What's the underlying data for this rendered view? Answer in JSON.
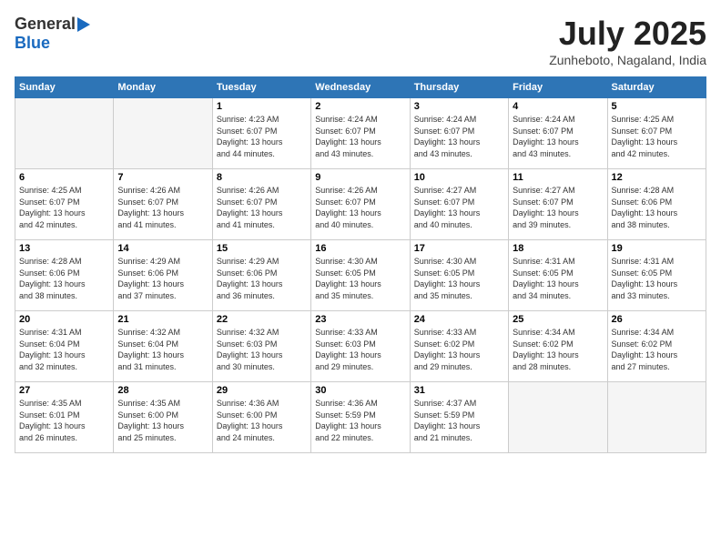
{
  "header": {
    "logo_general": "General",
    "logo_blue": "Blue",
    "month_title": "July 2025",
    "location": "Zunheboto, Nagaland, India"
  },
  "weekdays": [
    "Sunday",
    "Monday",
    "Tuesday",
    "Wednesday",
    "Thursday",
    "Friday",
    "Saturday"
  ],
  "weeks": [
    [
      {
        "day": "",
        "info": ""
      },
      {
        "day": "",
        "info": ""
      },
      {
        "day": "1",
        "info": "Sunrise: 4:23 AM\nSunset: 6:07 PM\nDaylight: 13 hours\nand 44 minutes."
      },
      {
        "day": "2",
        "info": "Sunrise: 4:24 AM\nSunset: 6:07 PM\nDaylight: 13 hours\nand 43 minutes."
      },
      {
        "day": "3",
        "info": "Sunrise: 4:24 AM\nSunset: 6:07 PM\nDaylight: 13 hours\nand 43 minutes."
      },
      {
        "day": "4",
        "info": "Sunrise: 4:24 AM\nSunset: 6:07 PM\nDaylight: 13 hours\nand 43 minutes."
      },
      {
        "day": "5",
        "info": "Sunrise: 4:25 AM\nSunset: 6:07 PM\nDaylight: 13 hours\nand 42 minutes."
      }
    ],
    [
      {
        "day": "6",
        "info": "Sunrise: 4:25 AM\nSunset: 6:07 PM\nDaylight: 13 hours\nand 42 minutes."
      },
      {
        "day": "7",
        "info": "Sunrise: 4:26 AM\nSunset: 6:07 PM\nDaylight: 13 hours\nand 41 minutes."
      },
      {
        "day": "8",
        "info": "Sunrise: 4:26 AM\nSunset: 6:07 PM\nDaylight: 13 hours\nand 41 minutes."
      },
      {
        "day": "9",
        "info": "Sunrise: 4:26 AM\nSunset: 6:07 PM\nDaylight: 13 hours\nand 40 minutes."
      },
      {
        "day": "10",
        "info": "Sunrise: 4:27 AM\nSunset: 6:07 PM\nDaylight: 13 hours\nand 40 minutes."
      },
      {
        "day": "11",
        "info": "Sunrise: 4:27 AM\nSunset: 6:07 PM\nDaylight: 13 hours\nand 39 minutes."
      },
      {
        "day": "12",
        "info": "Sunrise: 4:28 AM\nSunset: 6:06 PM\nDaylight: 13 hours\nand 38 minutes."
      }
    ],
    [
      {
        "day": "13",
        "info": "Sunrise: 4:28 AM\nSunset: 6:06 PM\nDaylight: 13 hours\nand 38 minutes."
      },
      {
        "day": "14",
        "info": "Sunrise: 4:29 AM\nSunset: 6:06 PM\nDaylight: 13 hours\nand 37 minutes."
      },
      {
        "day": "15",
        "info": "Sunrise: 4:29 AM\nSunset: 6:06 PM\nDaylight: 13 hours\nand 36 minutes."
      },
      {
        "day": "16",
        "info": "Sunrise: 4:30 AM\nSunset: 6:05 PM\nDaylight: 13 hours\nand 35 minutes."
      },
      {
        "day": "17",
        "info": "Sunrise: 4:30 AM\nSunset: 6:05 PM\nDaylight: 13 hours\nand 35 minutes."
      },
      {
        "day": "18",
        "info": "Sunrise: 4:31 AM\nSunset: 6:05 PM\nDaylight: 13 hours\nand 34 minutes."
      },
      {
        "day": "19",
        "info": "Sunrise: 4:31 AM\nSunset: 6:05 PM\nDaylight: 13 hours\nand 33 minutes."
      }
    ],
    [
      {
        "day": "20",
        "info": "Sunrise: 4:31 AM\nSunset: 6:04 PM\nDaylight: 13 hours\nand 32 minutes."
      },
      {
        "day": "21",
        "info": "Sunrise: 4:32 AM\nSunset: 6:04 PM\nDaylight: 13 hours\nand 31 minutes."
      },
      {
        "day": "22",
        "info": "Sunrise: 4:32 AM\nSunset: 6:03 PM\nDaylight: 13 hours\nand 30 minutes."
      },
      {
        "day": "23",
        "info": "Sunrise: 4:33 AM\nSunset: 6:03 PM\nDaylight: 13 hours\nand 29 minutes."
      },
      {
        "day": "24",
        "info": "Sunrise: 4:33 AM\nSunset: 6:02 PM\nDaylight: 13 hours\nand 29 minutes."
      },
      {
        "day": "25",
        "info": "Sunrise: 4:34 AM\nSunset: 6:02 PM\nDaylight: 13 hours\nand 28 minutes."
      },
      {
        "day": "26",
        "info": "Sunrise: 4:34 AM\nSunset: 6:02 PM\nDaylight: 13 hours\nand 27 minutes."
      }
    ],
    [
      {
        "day": "27",
        "info": "Sunrise: 4:35 AM\nSunset: 6:01 PM\nDaylight: 13 hours\nand 26 minutes."
      },
      {
        "day": "28",
        "info": "Sunrise: 4:35 AM\nSunset: 6:00 PM\nDaylight: 13 hours\nand 25 minutes."
      },
      {
        "day": "29",
        "info": "Sunrise: 4:36 AM\nSunset: 6:00 PM\nDaylight: 13 hours\nand 24 minutes."
      },
      {
        "day": "30",
        "info": "Sunrise: 4:36 AM\nSunset: 5:59 PM\nDaylight: 13 hours\nand 22 minutes."
      },
      {
        "day": "31",
        "info": "Sunrise: 4:37 AM\nSunset: 5:59 PM\nDaylight: 13 hours\nand 21 minutes."
      },
      {
        "day": "",
        "info": ""
      },
      {
        "day": "",
        "info": ""
      }
    ]
  ]
}
